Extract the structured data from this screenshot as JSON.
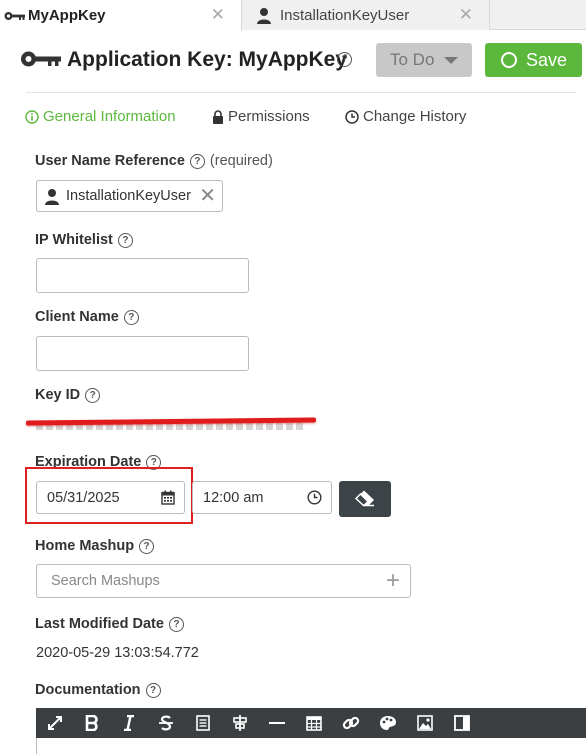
{
  "tabs": [
    {
      "label": "MyAppKey",
      "icon": "key-icon",
      "active": true
    },
    {
      "label": "InstallationKeyUser",
      "icon": "user-icon",
      "active": false
    }
  ],
  "header": {
    "title": "Application Key: MyAppKey",
    "state_label": "To Do",
    "save_label": "Save",
    "help_glyph": "?"
  },
  "nav": {
    "general": "General Information",
    "permissions": "Permissions",
    "history": "Change History"
  },
  "fields": {
    "user_name_ref": {
      "label": "User Name Reference",
      "required": "(required)",
      "value": "InstallationKeyUser"
    },
    "ip_whitelist": {
      "label": "IP Whitelist",
      "value": ""
    },
    "client_name": {
      "label": "Client Name",
      "value": ""
    },
    "key_id": {
      "label": "Key ID"
    },
    "expiration": {
      "label": "Expiration Date",
      "date": "05/31/2025",
      "time": "12:00 am"
    },
    "home_mashup": {
      "label": "Home Mashup",
      "placeholder": "Search Mashups"
    },
    "last_modified": {
      "label": "Last Modified Date",
      "value": "2020-05-29 13:03:54.772"
    },
    "documentation": {
      "label": "Documentation"
    }
  },
  "toolbar_icons": [
    "expand-icon",
    "bold-icon",
    "italic-icon",
    "strikethrough-icon",
    "list-icon",
    "align-icon",
    "horizontal-rule-icon",
    "table-icon",
    "link-icon",
    "palette-icon",
    "image-icon",
    "preview-icon"
  ],
  "colors": {
    "accent": "#5cb83c",
    "highlight": "#e02020",
    "toolbar": "#3b3f42"
  }
}
